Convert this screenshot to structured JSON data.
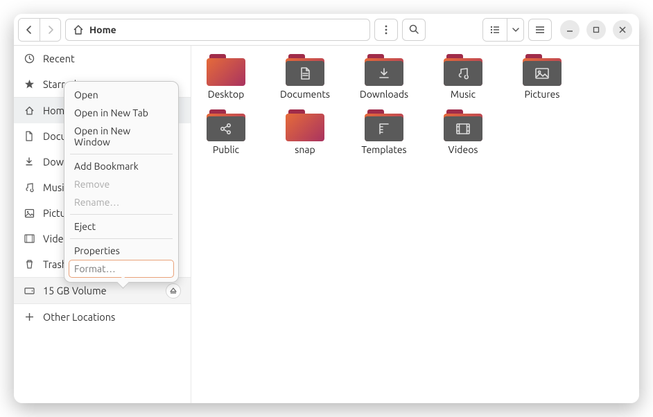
{
  "header": {
    "path_label": "Home"
  },
  "sidebar": {
    "items": [
      {
        "label": "Recent"
      },
      {
        "label": "Starred"
      },
      {
        "label": "Home"
      },
      {
        "label": "Documents"
      },
      {
        "label": "Downloads"
      },
      {
        "label": "Music"
      },
      {
        "label": "Pictures"
      },
      {
        "label": "Videos"
      },
      {
        "label": "Trash"
      }
    ],
    "volume": {
      "label": "15 GB Volume"
    },
    "other": {
      "label": "Other Locations"
    }
  },
  "folders": [
    {
      "name": "Desktop",
      "icon": "plain"
    },
    {
      "name": "Documents",
      "icon": "doc"
    },
    {
      "name": "Downloads",
      "icon": "down"
    },
    {
      "name": "Music",
      "icon": "music"
    },
    {
      "name": "Pictures",
      "icon": "pic"
    },
    {
      "name": "Public",
      "icon": "share"
    },
    {
      "name": "snap",
      "icon": "plain"
    },
    {
      "name": "Templates",
      "icon": "tmpl"
    },
    {
      "name": "Videos",
      "icon": "vid"
    }
  ],
  "context_menu": {
    "items": [
      {
        "label": "Open",
        "type": "item"
      },
      {
        "label": "Open in New Tab",
        "type": "item"
      },
      {
        "label": "Open in New Window",
        "type": "item"
      },
      {
        "type": "sep"
      },
      {
        "label": "Add Bookmark",
        "type": "item"
      },
      {
        "label": "Remove",
        "type": "disabled"
      },
      {
        "label": "Rename…",
        "type": "disabled"
      },
      {
        "type": "sep"
      },
      {
        "label": "Eject",
        "type": "item"
      },
      {
        "type": "sep"
      },
      {
        "label": "Properties",
        "type": "item"
      },
      {
        "label": "Format…",
        "type": "hl"
      }
    ]
  }
}
